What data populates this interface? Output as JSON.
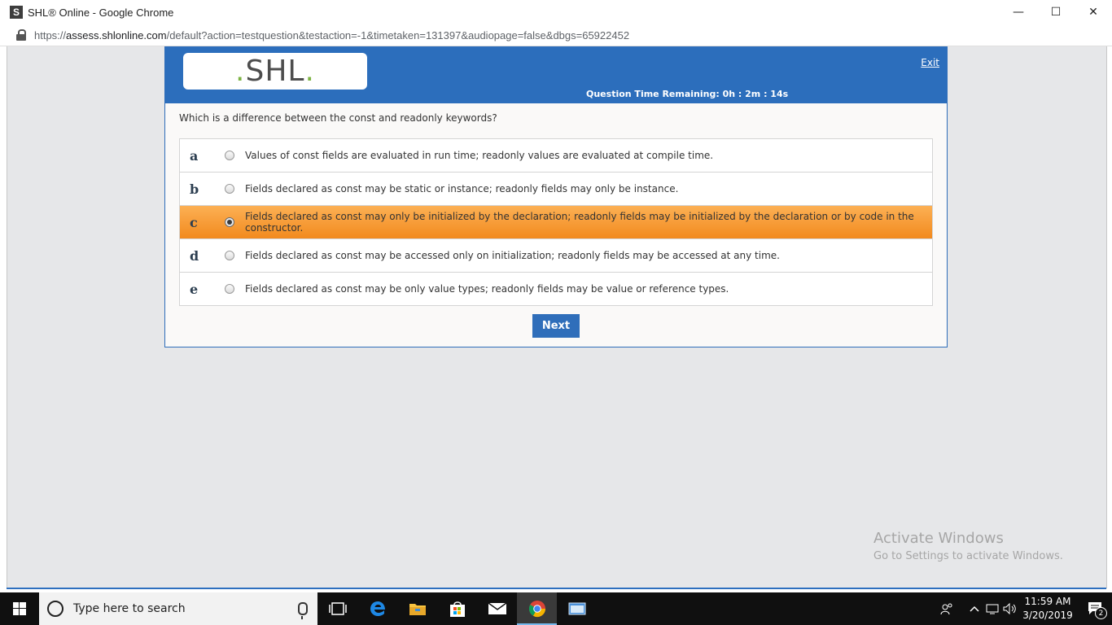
{
  "window": {
    "app_icon_letter": "S",
    "title": "SHL® Online - Google Chrome",
    "minimize": "—",
    "maximize": "☐",
    "close": "✕"
  },
  "address_bar": {
    "url_scheme": "https://",
    "url_host": "assess.shlonline.com",
    "url_path": "/default?action=testquestion&testaction=-1&timetaken=131397&audiopage=false&dbgs=65922452"
  },
  "header": {
    "logo_text": "SHL",
    "exit_label": "Exit",
    "timer_text": "Question Time Remaining: 0h : 2m : 14s"
  },
  "question": {
    "text": "Which is a difference between the const and readonly keywords?",
    "options": [
      {
        "letter": "a",
        "text": "Values of const fields are evaluated in run time; readonly values are evaluated at compile time.",
        "selected": false
      },
      {
        "letter": "b",
        "text": "Fields declared as const may be static or instance; readonly fields may only be instance.",
        "selected": false
      },
      {
        "letter": "c",
        "text": "Fields declared as const may only be initialized by the declaration; readonly fields may be initialized by the declaration or by code in the constructor.",
        "selected": true
      },
      {
        "letter": "d",
        "text": "Fields declared as const may be accessed only on initialization; readonly fields may be accessed at any time.",
        "selected": false
      },
      {
        "letter": "e",
        "text": "Fields declared as const may be only value types; readonly fields may be value or reference types.",
        "selected": false
      }
    ],
    "next_label": "Next"
  },
  "watermark": {
    "title": "Activate Windows",
    "subtitle": "Go to Settings to activate Windows."
  },
  "taskbar": {
    "search_placeholder": "Type here to search",
    "clock_time": "11:59 AM",
    "clock_date": "3/20/2019",
    "notification_count": "2",
    "apps": [
      "task-view",
      "edge",
      "file-explorer",
      "store",
      "mail",
      "chrome",
      "app"
    ]
  },
  "colors": {
    "header_blue": "#2c6ebc",
    "selected_orange": "#f59a2e",
    "logo_green": "#7cb342"
  }
}
